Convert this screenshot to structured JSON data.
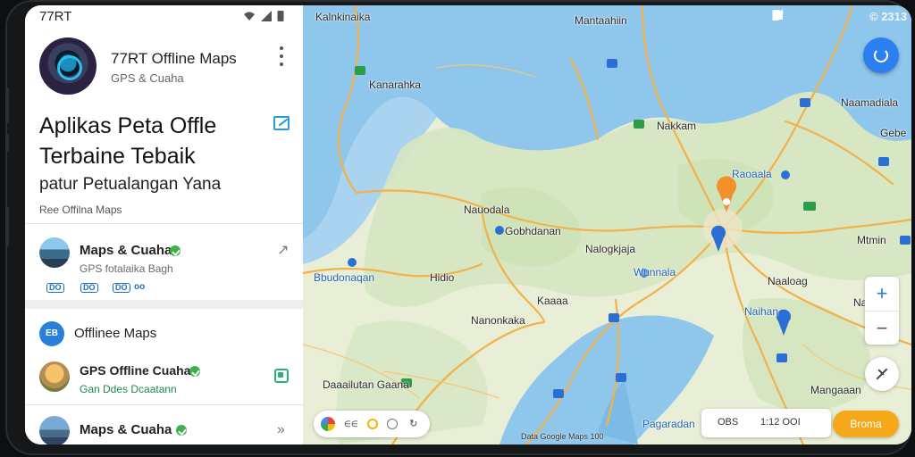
{
  "statusbar": {
    "left_label": "77RT",
    "right_time": "© 2313"
  },
  "app": {
    "name": "77RT Offline Maps",
    "subtitle": "GPS & Cuaha"
  },
  "hero": {
    "line1": "Aplikas Peta Offle",
    "line2": "Terbaine Tebaik",
    "tagline": "patur Petualangan Yana",
    "caption": "Ree Offilna Maps"
  },
  "card1": {
    "title": "Maps & Cuaha",
    "subtitle": "GPS fotalaika Bagh",
    "chips": [
      "DO",
      "DO",
      "DO",
      "oo"
    ]
  },
  "section": {
    "icon_text": "EB",
    "title": "Offlinee Maps"
  },
  "card2": {
    "title": "GPS Offline Cuaha",
    "subtitle": "Gan Ddes Dcaatann"
  },
  "card3": {
    "title": "Maps & Cuaha"
  },
  "map": {
    "labels": [
      {
        "text": "Kalnkinaika",
        "cls": ""
      },
      {
        "text": "Mantaahiin",
        "cls": ""
      },
      {
        "text": "Kanarahka",
        "cls": ""
      },
      {
        "text": "Naamadiala",
        "cls": ""
      },
      {
        "text": "Nakkam",
        "cls": ""
      },
      {
        "text": "Gebe",
        "cls": ""
      },
      {
        "text": "Raoaala",
        "cls": "blue"
      },
      {
        "text": "Nauodala",
        "cls": ""
      },
      {
        "text": "Gobhdanan",
        "cls": ""
      },
      {
        "text": "Nalogkjaja",
        "cls": ""
      },
      {
        "text": "Mtmin",
        "cls": ""
      },
      {
        "text": "Bbudonaqan",
        "cls": "blue"
      },
      {
        "text": "Hidio",
        "cls": ""
      },
      {
        "text": "Wunnala",
        "cls": "blue"
      },
      {
        "text": "Naaloag",
        "cls": ""
      },
      {
        "text": "Kaaaa",
        "cls": ""
      },
      {
        "text": "Nanarkka",
        "cls": ""
      },
      {
        "text": "Nanonkaka",
        "cls": ""
      },
      {
        "text": "Naihan",
        "cls": "blue"
      },
      {
        "text": "Daaailutan Gaana",
        "cls": ""
      },
      {
        "text": "Mangaaan",
        "cls": ""
      },
      {
        "text": "Pagaradan",
        "cls": "blue"
      }
    ],
    "controls": {
      "zoom_in": "+",
      "zoom_out": "−"
    },
    "bottom_bar": {
      "left_text": "OBS",
      "right_text": "1:12 OOI"
    },
    "action_button": "Broma",
    "attribution": "Data Google Maps 100"
  },
  "colors": {
    "water": "#8fc6ec",
    "land": "#e8efd6",
    "road": "#f2b14a",
    "accent": "#2b7ff0",
    "pin": "#f2902a"
  }
}
